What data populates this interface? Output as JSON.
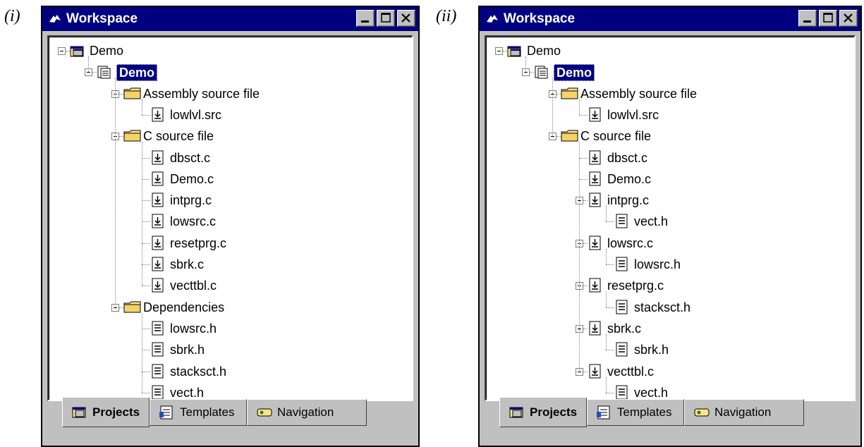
{
  "panels": [
    {
      "label": "(i)",
      "title": "Workspace",
      "tabs": {
        "projects": "Projects",
        "templates": "Templates",
        "navigation": "Navigation"
      },
      "tree": [
        {
          "label": "Demo",
          "icon": "workspace-icon",
          "depth": 0,
          "expander": true
        },
        {
          "label": "Demo",
          "icon": "project-icon",
          "depth": 1,
          "expander": true,
          "selected": true
        },
        {
          "label": "Assembly source file",
          "icon": "folder-icon",
          "depth": 2,
          "expander": true
        },
        {
          "label": "lowlvl.src",
          "icon": "source-file-icon",
          "depth": 3
        },
        {
          "label": "C source file",
          "icon": "folder-icon",
          "depth": 2,
          "expander": true
        },
        {
          "label": "dbsct.c",
          "icon": "source-file-icon",
          "depth": 3
        },
        {
          "label": "Demo.c",
          "icon": "source-file-icon",
          "depth": 3
        },
        {
          "label": "intprg.c",
          "icon": "source-file-icon",
          "depth": 3
        },
        {
          "label": "lowsrc.c",
          "icon": "source-file-icon",
          "depth": 3
        },
        {
          "label": "resetprg.c",
          "icon": "source-file-icon",
          "depth": 3
        },
        {
          "label": "sbrk.c",
          "icon": "source-file-icon",
          "depth": 3
        },
        {
          "label": "vecttbl.c",
          "icon": "source-file-icon",
          "depth": 3
        },
        {
          "label": "Dependencies",
          "icon": "folder-icon",
          "depth": 2,
          "expander": true
        },
        {
          "label": "lowsrc.h",
          "icon": "header-file-icon",
          "depth": 3
        },
        {
          "label": "sbrk.h",
          "icon": "header-file-icon",
          "depth": 3
        },
        {
          "label": "stacksct.h",
          "icon": "header-file-icon",
          "depth": 3
        },
        {
          "label": "vect.h",
          "icon": "header-file-icon",
          "depth": 3
        }
      ]
    },
    {
      "label": "(ii)",
      "title": "Workspace",
      "tabs": {
        "projects": "Projects",
        "templates": "Templates",
        "navigation": "Navigation"
      },
      "tree": [
        {
          "label": "Demo",
          "icon": "workspace-icon",
          "depth": 0,
          "expander": true
        },
        {
          "label": "Demo",
          "icon": "project-icon",
          "depth": 1,
          "expander": true,
          "selected": true
        },
        {
          "label": "Assembly source file",
          "icon": "folder-icon",
          "depth": 2,
          "expander": true
        },
        {
          "label": "lowlvl.src",
          "icon": "source-file-icon",
          "depth": 3
        },
        {
          "label": "C source file",
          "icon": "folder-icon",
          "depth": 2,
          "expander": true
        },
        {
          "label": "dbsct.c",
          "icon": "source-file-icon",
          "depth": 3
        },
        {
          "label": "Demo.c",
          "icon": "source-file-icon",
          "depth": 3
        },
        {
          "label": "intprg.c",
          "icon": "source-file-icon",
          "depth": 3,
          "expander": true
        },
        {
          "label": "vect.h",
          "icon": "header-file-icon",
          "depth": 4
        },
        {
          "label": "lowsrc.c",
          "icon": "source-file-icon",
          "depth": 3,
          "expander": true
        },
        {
          "label": "lowsrc.h",
          "icon": "header-file-icon",
          "depth": 4
        },
        {
          "label": "resetprg.c",
          "icon": "source-file-icon",
          "depth": 3,
          "expander": true
        },
        {
          "label": "stacksct.h",
          "icon": "header-file-icon",
          "depth": 4
        },
        {
          "label": "sbrk.c",
          "icon": "source-file-icon",
          "depth": 3,
          "expander": true
        },
        {
          "label": "sbrk.h",
          "icon": "header-file-icon",
          "depth": 4
        },
        {
          "label": "vecttbl.c",
          "icon": "source-file-icon",
          "depth": 3,
          "expander": true
        },
        {
          "label": "vect.h",
          "icon": "header-file-icon",
          "depth": 4
        }
      ]
    }
  ],
  "colors": {
    "titlebar": "#000080",
    "face": "#c0c0c0",
    "folder": "#ffe38a",
    "selection": "#000080"
  }
}
